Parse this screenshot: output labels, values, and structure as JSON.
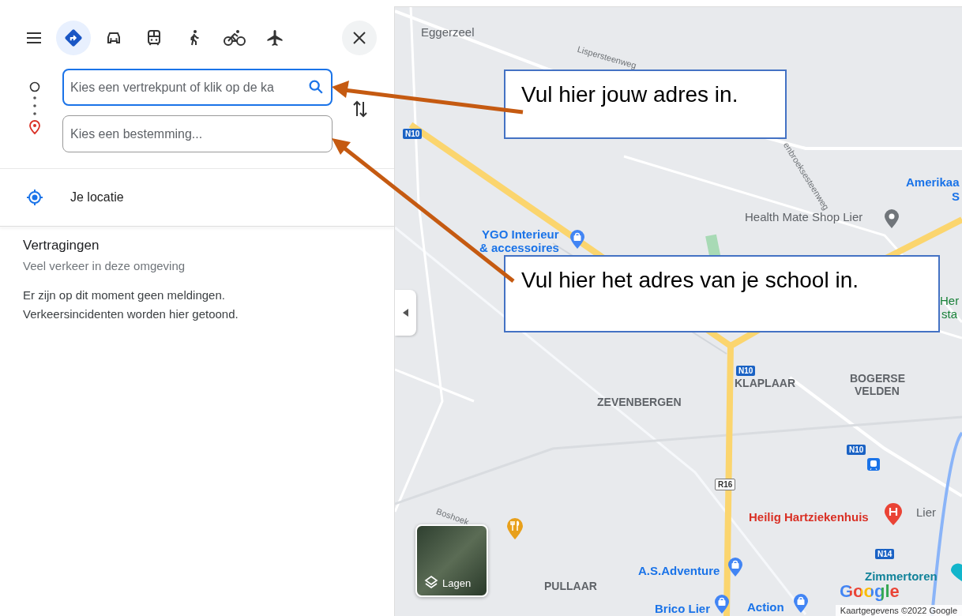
{
  "toolbar": {
    "modes": [
      {
        "kind": "directions",
        "selected": true
      },
      {
        "kind": "car",
        "selected": false
      },
      {
        "kind": "transit",
        "selected": false
      },
      {
        "kind": "walk",
        "selected": false
      },
      {
        "kind": "bicycle",
        "selected": false
      },
      {
        "kind": "flight",
        "selected": false
      }
    ]
  },
  "route": {
    "origin": {
      "placeholder": "Kies een vertrekpunt of klik op de ka",
      "focused": true
    },
    "destination": {
      "placeholder": "Kies een bestemming...",
      "focused": false
    }
  },
  "suggestions": [
    {
      "label": "Je locatie"
    }
  ],
  "delays": {
    "title": "Vertragingen",
    "subtitle": "Veel verkeer in deze omgeving",
    "message_lines": [
      "Er zijn op dit moment geen meldingen.",
      "Verkeersincidenten worden hier getoond."
    ]
  },
  "map": {
    "labels": [
      {
        "text": "Eggerzeel",
        "kind": "place"
      },
      {
        "text": "Lispersteenweg",
        "kind": "street"
      },
      {
        "text": "enbroeksesteenweg",
        "kind": "street"
      },
      {
        "text": "Amerikaa",
        "kind": "poi"
      },
      {
        "text": "S",
        "kind": "poi"
      },
      {
        "text": "Health Mate Shop Lier",
        "kind": "shop"
      },
      {
        "text": "YGO Interieur",
        "kind": "poi"
      },
      {
        "text": "& accessoires",
        "kind": "poi"
      },
      {
        "text": "N10",
        "kind": "road"
      },
      {
        "text": "Her",
        "kind": "park"
      },
      {
        "text": "sta",
        "kind": "park"
      },
      {
        "text": "N10",
        "kind": "road"
      },
      {
        "text": "KLAPLAAR",
        "kind": "district"
      },
      {
        "text": "BOGERSE",
        "kind": "district"
      },
      {
        "text": "VELDEN",
        "kind": "district"
      },
      {
        "text": "ZEVENBERGEN",
        "kind": "district"
      },
      {
        "text": "N10",
        "kind": "road"
      },
      {
        "text": "R16",
        "kind": "ring"
      },
      {
        "text": "Boshoek",
        "kind": "street"
      },
      {
        "text": "Heilig Hartziekenhuis",
        "kind": "hospital"
      },
      {
        "text": "Lier",
        "kind": "place"
      },
      {
        "text": "N14",
        "kind": "road"
      },
      {
        "text": "A.S.Adventure",
        "kind": "poi"
      },
      {
        "text": "Zimmertoren",
        "kind": "attraction"
      },
      {
        "text": "PULLAAR",
        "kind": "district"
      },
      {
        "text": "Brico Lier",
        "kind": "poi"
      },
      {
        "text": "Action",
        "kind": "poi"
      }
    ],
    "logo": "Google",
    "layers_button": "Lagen",
    "attribution": "Kaartgegevens ©2022 Google"
  },
  "callouts": [
    {
      "text": "Vul hier jouw adres in."
    },
    {
      "text": "Vul hier het adres van je school in."
    }
  ]
}
